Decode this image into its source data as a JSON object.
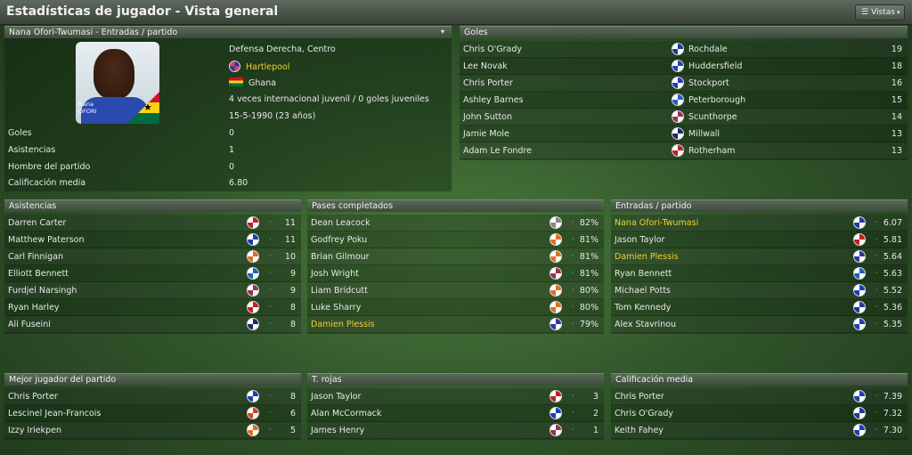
{
  "title": "Estadísticas de jugador - Vista general",
  "views_button": "Vistas",
  "profile": {
    "header": "Nana Ofori-Twumasi - Entradas / partido",
    "position": "Defensa Derecha, Centro",
    "club": "Hartlepool",
    "nation": "Ghana",
    "caps": "4 veces internacional juvenil / 0 goles juveniles",
    "dob": "15-5-1990 (23 años)",
    "photo_name_line1": "Nana",
    "photo_name_line2": "OFORI",
    "stats": [
      {
        "label": "Goles",
        "value": "0"
      },
      {
        "label": "Asistencias",
        "value": "1"
      },
      {
        "label": "Hombre del partido",
        "value": "0"
      },
      {
        "label": "Calificación media",
        "value": "6.80"
      }
    ]
  },
  "goals": {
    "header": "Goles",
    "rows": [
      {
        "name": "Chris O'Grady",
        "club": "Rochdale",
        "value": "19",
        "color": "#1a3a9a"
      },
      {
        "name": "Lee Novak",
        "club": "Huddersfield",
        "value": "18",
        "color": "#1a4ab0"
      },
      {
        "name": "Chris Porter",
        "club": "Stockport",
        "value": "16",
        "color": "#1a40b8"
      },
      {
        "name": "Ashley Barnes",
        "club": "Peterborough",
        "value": "15",
        "color": "#2060c0"
      },
      {
        "name": "John Sutton",
        "club": "Scunthorpe",
        "value": "14",
        "color": "#9a3050"
      },
      {
        "name": "Jamie Mole",
        "club": "Millwall",
        "value": "13",
        "color": "#1a2a6a"
      },
      {
        "name": "Adam Le Fondre",
        "club": "Rotherham",
        "value": "13",
        "color": "#c02020"
      }
    ]
  },
  "assists": {
    "header": "Asistencias",
    "rows": [
      {
        "name": "Darren Carter",
        "value": "11",
        "color": "#c02020",
        "hl": false
      },
      {
        "name": "Matthew Paterson",
        "value": "11",
        "color": "#1a40b8",
        "hl": false
      },
      {
        "name": "Carl Finnigan",
        "value": "10",
        "color": "#e07020",
        "hl": false
      },
      {
        "name": "Elliott Bennett",
        "value": "9",
        "color": "#2060c0",
        "hl": false
      },
      {
        "name": "Furdjel Narsingh",
        "value": "9",
        "color": "#9a3050",
        "hl": false
      },
      {
        "name": "Ryan Harley",
        "value": "8",
        "color": "#c02020",
        "hl": false
      },
      {
        "name": "Ali Fuseini",
        "value": "8",
        "color": "#1a2a6a",
        "hl": false
      }
    ]
  },
  "passes": {
    "header": "Pases completados",
    "rows": [
      {
        "name": "Dean Leacock",
        "value": "82%",
        "color": "#888888",
        "hl": false
      },
      {
        "name": "Godfrey Poku",
        "value": "81%",
        "color": "#e07020",
        "hl": false
      },
      {
        "name": "Brian Gilmour",
        "value": "81%",
        "color": "#e07020",
        "hl": false
      },
      {
        "name": "Josh Wright",
        "value": "81%",
        "color": "#9a3050",
        "hl": false
      },
      {
        "name": "Liam Bridcutt",
        "value": "80%",
        "color": "#e07020",
        "hl": false
      },
      {
        "name": "Luke Sharry",
        "value": "80%",
        "color": "#e07020",
        "hl": false
      },
      {
        "name": "Damien Plessis",
        "value": "79%",
        "color": "#2a3a9a",
        "hl": true
      }
    ]
  },
  "tackles": {
    "header": "Entradas / partido",
    "rows": [
      {
        "name": "Nana Ofori-Twumasi",
        "value": "6.07",
        "color": "#2a3a9a",
        "hl": true
      },
      {
        "name": "Jason Taylor",
        "value": "5.81",
        "color": "#c02020",
        "hl": false
      },
      {
        "name": "Damien Plessis",
        "value": "5.64",
        "color": "#2a3a9a",
        "hl": true
      },
      {
        "name": "Ryan Bennett",
        "value": "5.63",
        "color": "#2060c0",
        "hl": false
      },
      {
        "name": "Michael Potts",
        "value": "5.52",
        "color": "#1a40b8",
        "hl": false
      },
      {
        "name": "Tom Kennedy",
        "value": "5.36",
        "color": "#1a3a9a",
        "hl": false
      },
      {
        "name": "Alex Stavrinou",
        "value": "5.35",
        "color": "#1a40b8",
        "hl": false
      }
    ]
  },
  "motm": {
    "header": "Mejor jugador del partido",
    "rows": [
      {
        "name": "Chris Porter",
        "value": "8",
        "color": "#1a40b8",
        "hl": false
      },
      {
        "name": "Lescinel Jean-Francois",
        "value": "6",
        "color": "#e04020",
        "hl": false
      },
      {
        "name": "Izzy Iriekpen",
        "value": "5",
        "color": "#e07020",
        "hl": false
      }
    ]
  },
  "reds": {
    "header": "T. rojas",
    "rows": [
      {
        "name": "Jason Taylor",
        "value": "3",
        "color": "#c02020",
        "hl": false
      },
      {
        "name": "Alan McCormack",
        "value": "2",
        "color": "#1a40b8",
        "hl": false
      },
      {
        "name": "James Henry",
        "value": "1",
        "color": "#9a3050",
        "hl": false
      }
    ]
  },
  "ratings": {
    "header": "Calificación media",
    "rows": [
      {
        "name": "Chris Porter",
        "value": "7.39",
        "color": "#1a40b8",
        "hl": false
      },
      {
        "name": "Chris O'Grady",
        "value": "7.32",
        "color": "#1a3a9a",
        "hl": false
      },
      {
        "name": "Keith Fahey",
        "value": "7.30",
        "color": "#1a40b8",
        "hl": false
      }
    ]
  }
}
